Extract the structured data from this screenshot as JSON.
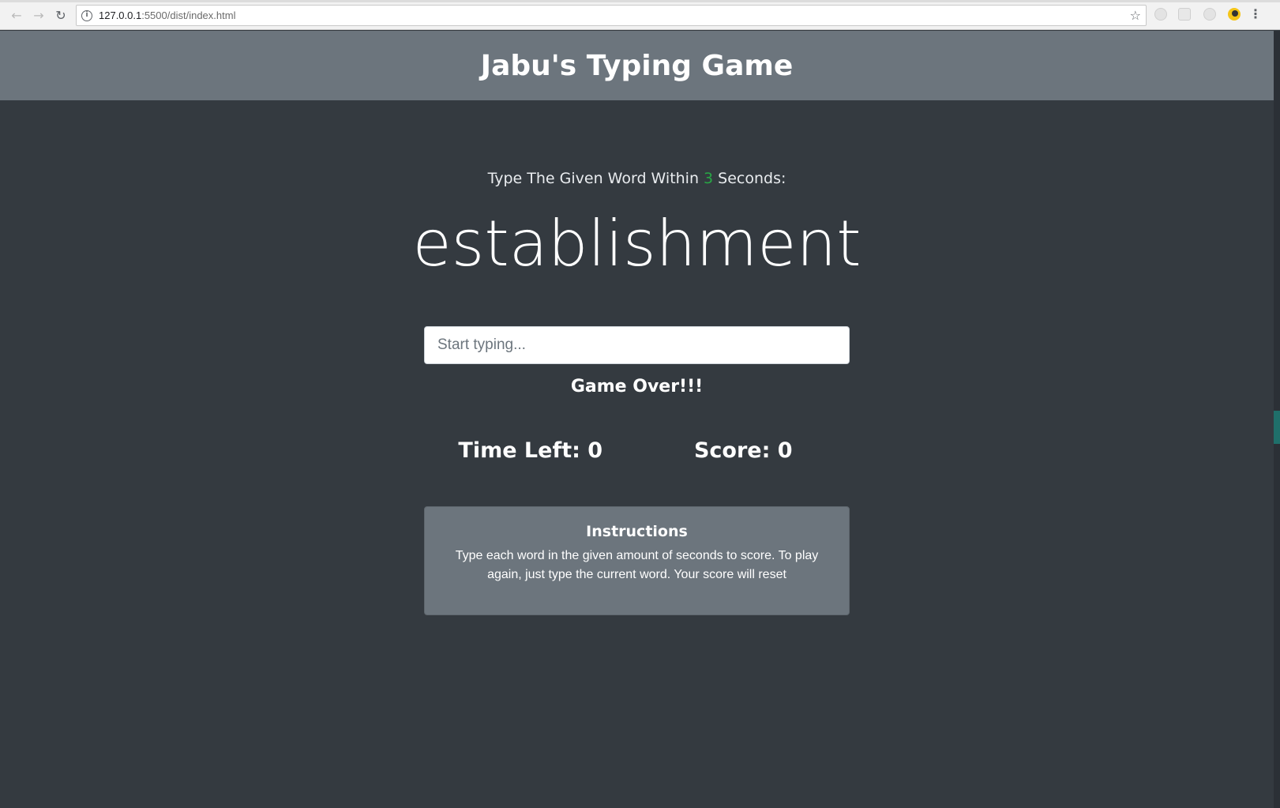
{
  "browser": {
    "url_host": "127.0.0.1",
    "url_rest": ":5500/dist/index.html"
  },
  "header": {
    "title": "Jabu's Typing Game"
  },
  "game": {
    "lead_prefix": "Type The Given Word Within ",
    "seconds": "3",
    "lead_suffix": " Seconds:",
    "current_word": "establishment",
    "input_placeholder": "Start typing...",
    "message": "Game Over!!!",
    "time_left_label": "Time Left: ",
    "time_left_value": "0",
    "score_label": "Score: ",
    "score_value": "0"
  },
  "instructions": {
    "title": "Instructions",
    "body": "Type each word in the given amount of seconds to score. To play again, just type the current word. Your score will reset"
  },
  "colors": {
    "page_bg": "#343a40",
    "header_bg": "#6c757d",
    "seconds_accent": "#28a745"
  },
  "icons": [
    "back-arrow-icon",
    "forward-arrow-icon",
    "reload-icon",
    "info-icon",
    "star-icon",
    "kebab-menu-icon"
  ]
}
